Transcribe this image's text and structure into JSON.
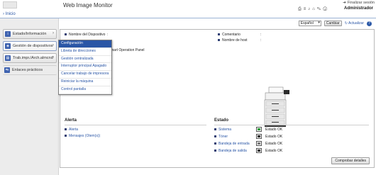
{
  "header": {
    "app_title": "Web Image Monitor",
    "logout_label": "Finalizar sesión",
    "user": "Administrador",
    "icons": [
      "printer-icon",
      "list-icon",
      "bell-icon",
      "home-icon",
      "tool-icon",
      "info-icon"
    ]
  },
  "breadcrumb": {
    "home": "Inicio"
  },
  "toolbar": {
    "language": "Español",
    "change_label": "Cambiar",
    "refresh_label": "Actualizar"
  },
  "sidebar": {
    "items": [
      {
        "label": "Estado/Información",
        "icon": "info-icon"
      },
      {
        "label": "Gestión de dispositivos",
        "icon": "gear-icon"
      },
      {
        "label": "Trab.impr./Arch.almcnd",
        "icon": "document-icon"
      },
      {
        "label": "Enlaces prácticos",
        "icon": "link-icon"
      }
    ]
  },
  "device_info": {
    "name_label": "Nombre del Dispositivo",
    "comment_label": "Comentario",
    "host_label": "Nombre de host",
    "colon": ":",
    "panel_text": "mart Operation Panel"
  },
  "dropdown": {
    "items": [
      "Configuración",
      "Libreta de direcciones",
      "Gestión centralizada",
      "Interruptor principal Apagado",
      "Cancelar trabajo de impresora",
      "Reiniciar la máquina",
      "Control pantalla"
    ]
  },
  "alert": {
    "title": "Alerta",
    "links": [
      "Alerta",
      "Mensajes (Otem(s))"
    ]
  },
  "status": {
    "title": "Estado",
    "rows": [
      {
        "label": "Sistema",
        "state": "Estado OK",
        "color": "#2e9a3a"
      },
      {
        "label": "Tóner",
        "state": "Estado OK",
        "color": "#111111"
      },
      {
        "label": "Bandeja de entrada",
        "state": "Estado OK",
        "color": "#777777"
      },
      {
        "label": "Bandeja de salida",
        "state": "Estado OK",
        "color": "#111111"
      }
    ],
    "check_label": "Comprobar detalles"
  }
}
